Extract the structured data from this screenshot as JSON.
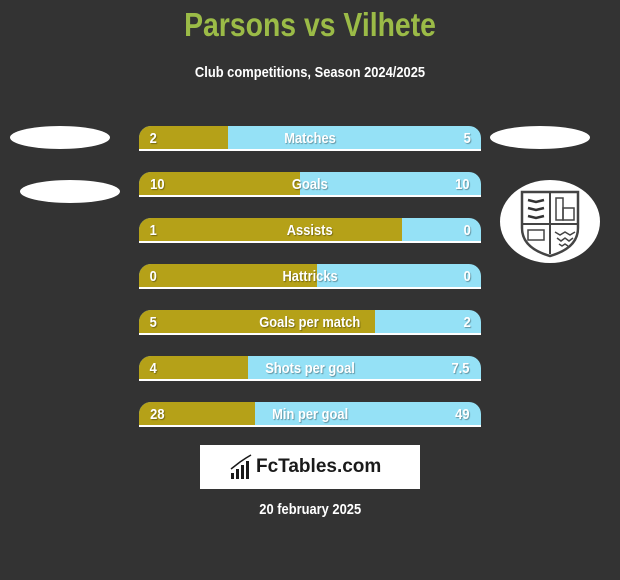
{
  "header": {
    "title": "Parsons vs Vilhete",
    "subtitle": "Club competitions, Season 2024/2025"
  },
  "colors": {
    "background": "#333333",
    "title": "#9bbb47",
    "left_bar": "#b5a118",
    "right_bar": "#95e1f6"
  },
  "chart_data": {
    "type": "bar",
    "orientation": "horizontal-comparison",
    "title": "Parsons vs Vilhete",
    "subtitle": "Club competitions, Season 2024/2025",
    "series": [
      {
        "name": "Parsons",
        "color": "#b5a118"
      },
      {
        "name": "Vilhete",
        "color": "#95e1f6"
      }
    ],
    "categories": [
      "Matches",
      "Goals",
      "Assists",
      "Hattricks",
      "Goals per match",
      "Shots per goal",
      "Min per goal"
    ],
    "rows": [
      {
        "label": "Matches",
        "left": "2",
        "right": "5",
        "left_share": 0.26
      },
      {
        "label": "Goals",
        "left": "10",
        "right": "10",
        "left_share": 0.47
      },
      {
        "label": "Assists",
        "left": "1",
        "right": "0",
        "left_share": 0.77
      },
      {
        "label": "Hattricks",
        "left": "0",
        "right": "0",
        "left_share": 0.52
      },
      {
        "label": "Goals per match",
        "left": "5",
        "right": "2",
        "left_share": 0.69
      },
      {
        "label": "Shots per goal",
        "left": "4",
        "right": "7.5",
        "left_share": 0.32
      },
      {
        "label": "Min per goal",
        "left": "28",
        "right": "49",
        "left_share": 0.34
      }
    ]
  },
  "logo": {
    "text": "FcTables.com",
    "icon": "bar-chart-trend-icon"
  },
  "footer": {
    "date": "20 february 2025"
  },
  "badge": {
    "icon": "club-crest-shield-icon"
  }
}
